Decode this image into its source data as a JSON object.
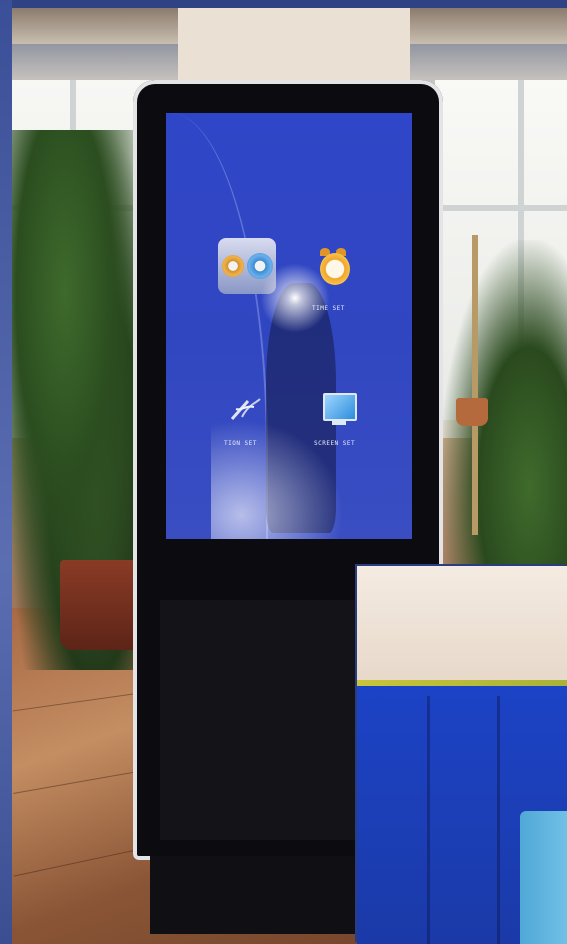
{
  "scene": "Free-standing touchscreen kiosk in a room with windows and plants",
  "screen": {
    "menu_items": [
      {
        "id": "system",
        "label": "",
        "icon": "gears-icon",
        "active": true
      },
      {
        "id": "time",
        "label": "TIME SET",
        "icon": "alarm-clock-icon",
        "active": false
      },
      {
        "id": "action",
        "label": "TION SET",
        "icon": "wand-icon",
        "active": false
      },
      {
        "id": "screen",
        "label": "SCREEN SET",
        "icon": "monitor-icon",
        "active": false
      }
    ]
  },
  "colors": {
    "screen_blue": "#3046c1",
    "active_label": "#e86a3c",
    "kiosk_body": "#0c0c10",
    "frame_border": "#2f4384"
  }
}
